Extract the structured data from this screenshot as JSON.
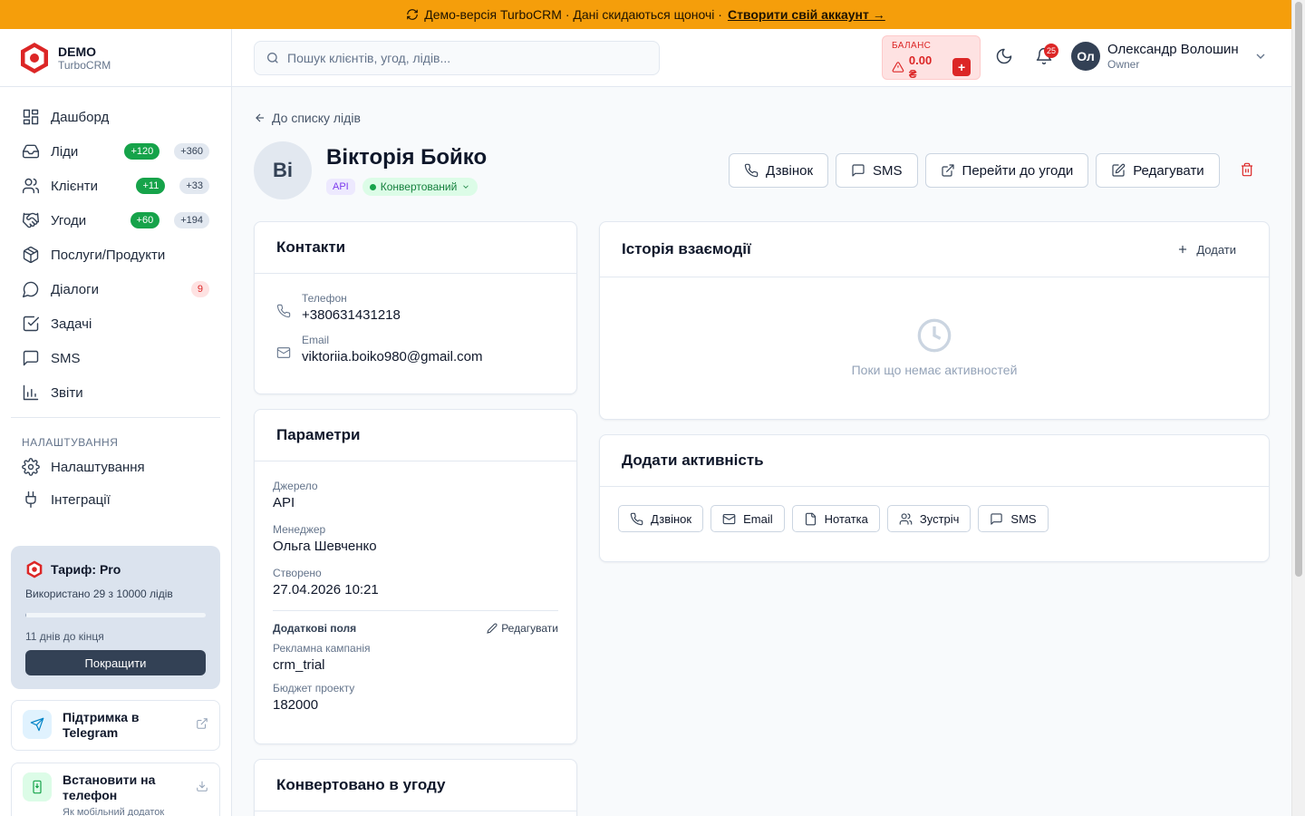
{
  "banner": {
    "text": "Демо-версія TurboCRM · Дані скидаються щоночі ·",
    "link": "Створити свій аккаунт →"
  },
  "brand": {
    "title": "DEMO",
    "subtitle": "TurboCRM"
  },
  "nav": [
    {
      "label": "Дашборд",
      "icon": "dashboard-icon"
    },
    {
      "label": "Ліди",
      "icon": "inbox-icon",
      "badge1": "+120",
      "badge2": "+360"
    },
    {
      "label": "Клієнти",
      "icon": "users-icon",
      "badge1": "+11",
      "badge2": "+33"
    },
    {
      "label": "Угоди",
      "icon": "handshake-icon",
      "badge1": "+60",
      "badge2": "+194"
    },
    {
      "label": "Послуги/Продукти",
      "icon": "package-icon"
    },
    {
      "label": "Діалоги",
      "icon": "chat-icon",
      "badge": "9"
    },
    {
      "label": "Задачі",
      "icon": "checkbox-icon"
    },
    {
      "label": "SMS",
      "icon": "message-icon"
    },
    {
      "label": "Звіти",
      "icon": "chart-icon"
    }
  ],
  "settings_section": "НАЛАШТУВАННЯ",
  "settings_nav": [
    {
      "label": "Налаштування",
      "icon": "gear-icon"
    },
    {
      "label": "Інтеграції",
      "icon": "plug-icon"
    }
  ],
  "plan": {
    "title": "Тариф: Pro",
    "used": "Використано 29 з 10000 лідів",
    "used_fraction": 0.0029,
    "days_left": "11 днів до кінця",
    "upgrade": "Покращити"
  },
  "support": {
    "label": "Підтримка в Telegram"
  },
  "install": {
    "label": "Встановити на телефон",
    "sub": "Як мобільний додаток"
  },
  "search": {
    "placeholder": "Пошук клієнтів, угод, лідів..."
  },
  "balance": {
    "caption": "БАЛАНС",
    "amount": "0.00 ₴"
  },
  "notifications": {
    "count": "25"
  },
  "user": {
    "initials": "Ол",
    "name": "Олександр Волошин",
    "role": "Owner"
  },
  "lead": {
    "back": "До списку лідів",
    "initials": "Ві",
    "name": "Вікторія Бойко",
    "source_tag": "API",
    "status": "Конвертований"
  },
  "actions": {
    "call": "Дзвінок",
    "sms": "SMS",
    "deal": "Перейти до угоди",
    "edit": "Редагувати"
  },
  "contacts": {
    "title": "Контакти",
    "phone_label": "Телефон",
    "phone": "+380631431218",
    "email_label": "Email",
    "email": "viktoriia.boiko980@gmail.com"
  },
  "params": {
    "title": "Параметри",
    "source_label": "Джерело",
    "source": "API",
    "manager_label": "Менеджер",
    "manager": "Ольга Шевченко",
    "created_label": "Створено",
    "created": "27.04.2026 10:21",
    "extra_title": "Додаткові поля",
    "extra_edit": "Редагувати",
    "campaign_label": "Рекламна кампанія",
    "campaign": "crm_trial",
    "budget_label": "Бюджет проекту",
    "budget": "182000"
  },
  "converted": {
    "title": "Конвертовано в угоду"
  },
  "history": {
    "title": "Історія взаємодії",
    "add": "Додати",
    "empty": "Поки що немає активностей"
  },
  "add_activity": {
    "title": "Додати активність",
    "buttons": [
      "Дзвінок",
      "Email",
      "Нотатка",
      "Зустріч",
      "SMS"
    ]
  }
}
